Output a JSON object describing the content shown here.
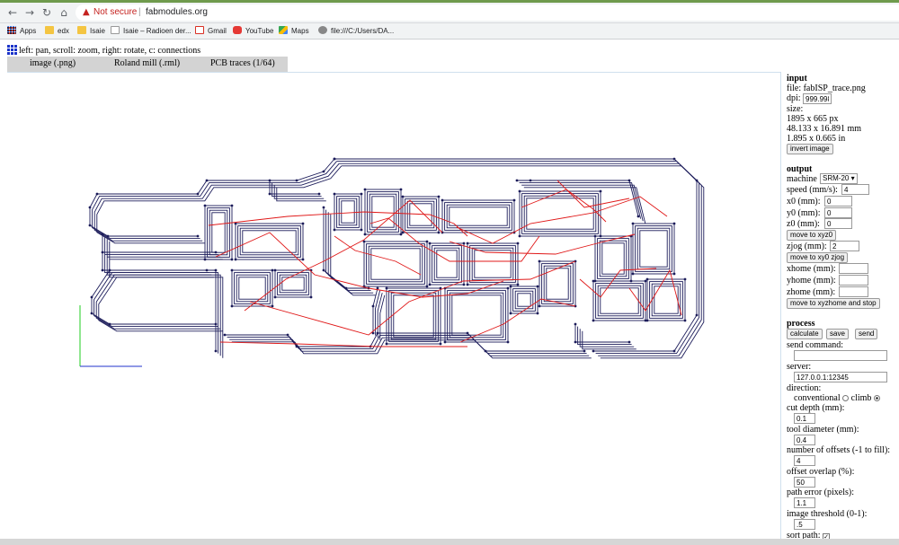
{
  "browser": {
    "url": "fabmodules.org",
    "security_label": "Not secure",
    "bookmarks": [
      "Apps",
      "edx",
      "Isaie",
      "Isaie – Radioen der...",
      "Gmail",
      "YouTube",
      "Maps",
      "file:///C:/Users/DA..."
    ]
  },
  "app": {
    "hint": "left: pan, scroll: zoom, right: rotate, c: connections",
    "tabs": [
      "image (.png)",
      "Roland mill (.rml)",
      "PCB traces (1/64)"
    ]
  },
  "input": {
    "heading": "input",
    "file_label": "file: fabISP_trace.png",
    "dpi_label": "dpi:",
    "dpi_value": "999.998",
    "size_label": "size:",
    "size_px": "1895 x 665 px",
    "size_mm": "48.133 x 16.891 mm",
    "size_in": "1.895 x 0.665 in",
    "invert_button": "invert image"
  },
  "output": {
    "heading": "output",
    "machine_label": "machine",
    "machine_value": "SRM-20",
    "speed_label": "speed (mm/s):",
    "speed_value": "4",
    "x0_label": "x0 (mm):",
    "x0_value": "0",
    "y0_label": "y0 (mm):",
    "y0_value": "0",
    "z0_label": "z0 (mm):",
    "z0_value": "0",
    "move_xyz0": "move to xyz0",
    "zjog_label": "zjog (mm):",
    "zjog_value": "2",
    "move_xy0zjog": "move to xy0 zjog",
    "xhome_label": "xhome (mm):",
    "yhome_label": "yhome (mm):",
    "zhome_label": "zhome (mm):",
    "move_home": "move to xyzhome and stop"
  },
  "process": {
    "heading": "process",
    "calculate": "calculate",
    "save": "save",
    "send": "send",
    "send_command_label": "send command:",
    "server_label": "server:",
    "server_value": "127.0.0.1:12345",
    "direction_label": "direction:",
    "conventional_label": "conventional",
    "climb_label": "climb",
    "direction_selected": "climb",
    "cut_depth_label": "cut depth (mm):",
    "cut_depth_value": "0.1",
    "tool_diameter_label": "tool diameter (mm):",
    "tool_diameter_value": "0.4",
    "offsets_label": "number of offsets (-1 to fill):",
    "offsets_value": "4",
    "overlap_label": "offset overlap (%):",
    "overlap_value": "50",
    "path_error_label": "path error (pixels):",
    "path_error_value": "1.1",
    "threshold_label": "image threshold (0-1):",
    "threshold_value": ".5",
    "sort_path_label": "sort path:",
    "sort_path_checked": true
  },
  "colors": {
    "trace": "#1c1c5a",
    "connection": "#e01818",
    "axis_x": "#2233cc",
    "axis_y": "#22cc22"
  }
}
